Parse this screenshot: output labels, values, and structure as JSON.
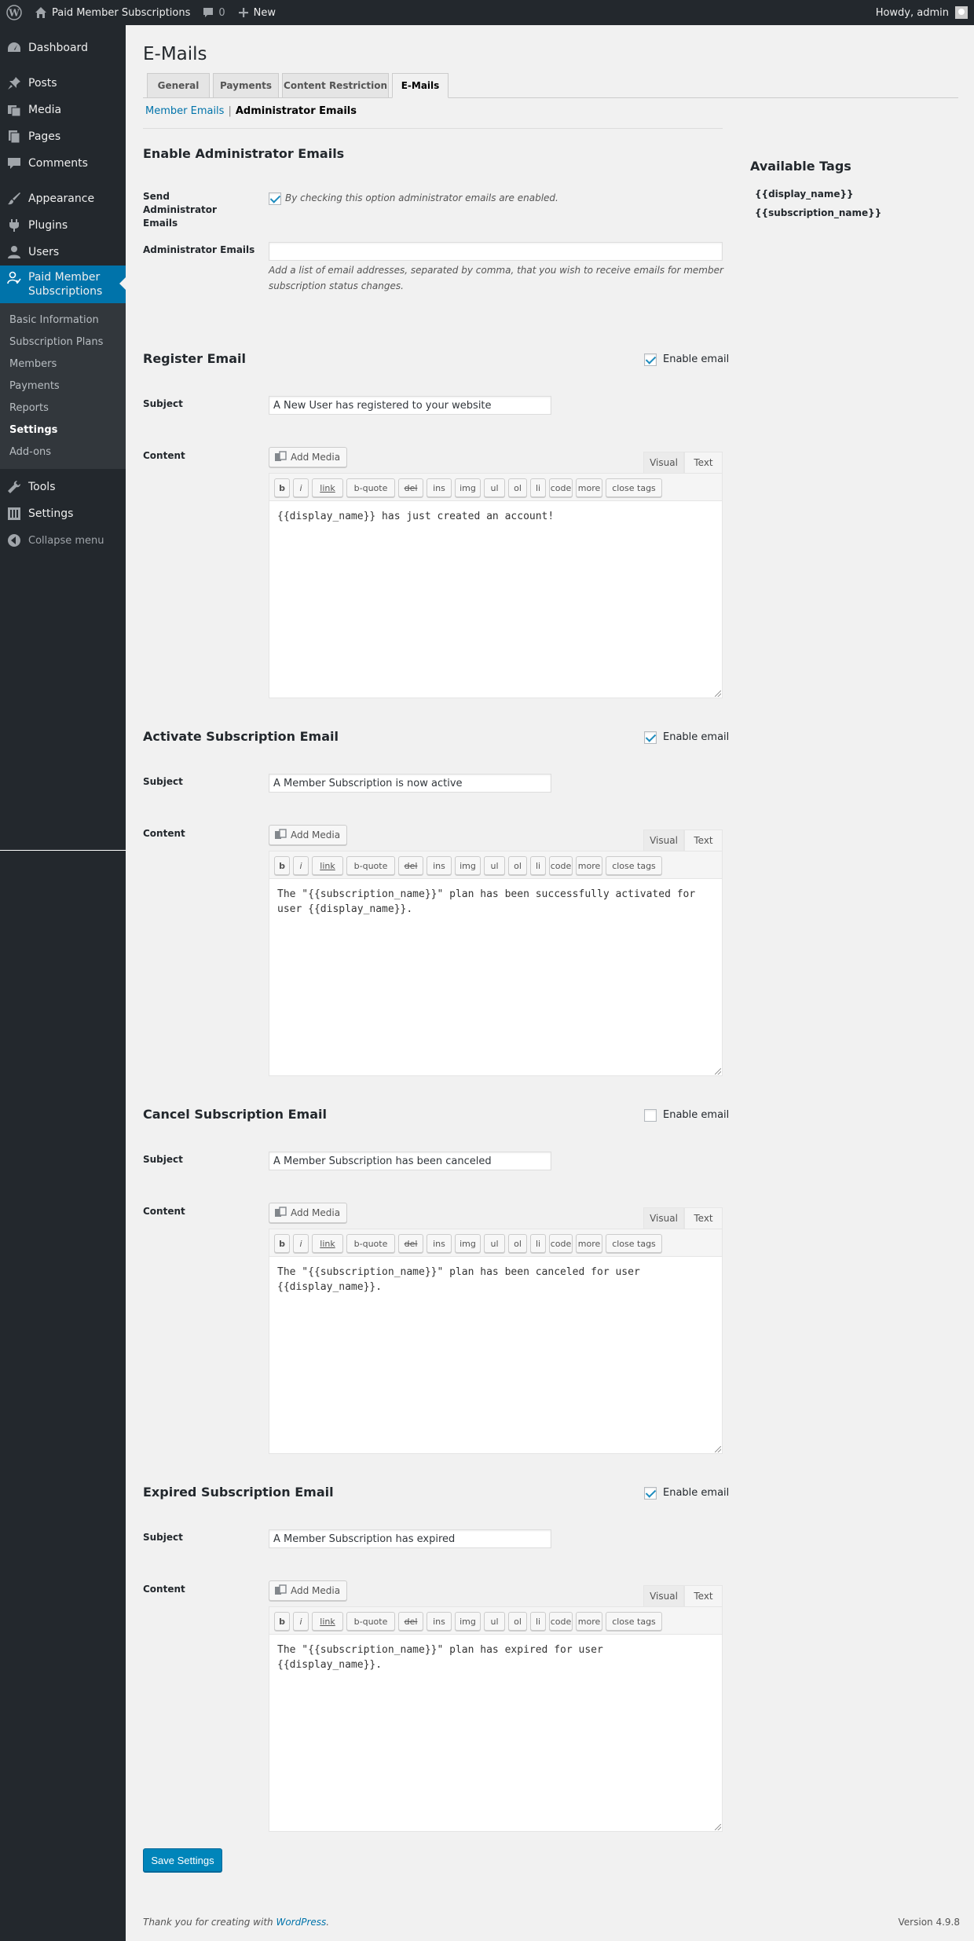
{
  "adminbar": {
    "site_name": "Paid Member Subscriptions",
    "comments_count": "0",
    "new_label": "New",
    "howdy": "Howdy, admin"
  },
  "sidebar": {
    "items": [
      {
        "label": "Dashboard",
        "icon": "dashboard-icon"
      },
      {
        "label": "Posts",
        "icon": "pin-icon"
      },
      {
        "label": "Media",
        "icon": "media-icon"
      },
      {
        "label": "Pages",
        "icon": "pages-icon"
      },
      {
        "label": "Comments",
        "icon": "comments-icon"
      },
      {
        "label": "Appearance",
        "icon": "brush-icon"
      },
      {
        "label": "Plugins",
        "icon": "plug-icon"
      },
      {
        "label": "Users",
        "icon": "users-icon"
      },
      {
        "label": "Paid Member Subscriptions",
        "icon": "member-icon"
      },
      {
        "label": "Tools",
        "icon": "wrench-icon"
      },
      {
        "label": "Settings",
        "icon": "settings-icon"
      }
    ],
    "submenu": [
      "Basic Information",
      "Subscription Plans",
      "Members",
      "Payments",
      "Reports",
      "Settings",
      "Add-ons"
    ],
    "collapse_label": "Collapse menu"
  },
  "page": {
    "title": "E-Mails",
    "tabs": [
      "General",
      "Payments",
      "Content Restriction",
      "E-Mails"
    ],
    "subnav": {
      "member": "Member Emails",
      "sep": "|",
      "admin": "Administrator Emails"
    }
  },
  "admin_section": {
    "title": "Enable Administrator Emails",
    "send_label": "Send Administrator Emails",
    "send_desc": "By checking this option administrator emails are enabled.",
    "send_checked": true,
    "emails_label": "Administrator Emails",
    "emails_value": "",
    "emails_desc_1": "Add a list of email addresses, separated by comma, that you wish to receive emails for member",
    "emails_desc_2": "subscription status changes."
  },
  "common": {
    "enable_email": "Enable email",
    "subject_label": "Subject",
    "content_label": "Content",
    "add_media": "Add Media",
    "visual_tab": "Visual",
    "text_tab": "Text",
    "qt_buttons": [
      "b",
      "i",
      "link",
      "b-quote",
      "del",
      "ins",
      "img",
      "ul",
      "ol",
      "li",
      "code",
      "more",
      "close tags"
    ]
  },
  "emails": [
    {
      "title": "Register Email",
      "enabled": true,
      "subject": "A New User has registered to your website",
      "content": "{{display_name}} has just created an account!"
    },
    {
      "title": "Activate Subscription Email",
      "enabled": true,
      "subject": "A Member Subscription is now active",
      "content": "The \"{{subscription_name}}\" plan has been successfully activated for\nuser {{display_name}}."
    },
    {
      "title": "Cancel Subscription Email",
      "enabled": false,
      "subject": "A Member Subscription has been canceled",
      "content": "The \"{{subscription_name}}\" plan has been canceled for user\n{{display_name}}."
    },
    {
      "title": "Expired Subscription Email",
      "enabled": true,
      "subject": "A Member Subscription has expired",
      "content": "The \"{{subscription_name}}\" plan has expired for user\n{{display_name}}."
    }
  ],
  "tags_panel": {
    "title": "Available Tags",
    "tags": [
      "{{display_name}}",
      "{{subscription_name}}"
    ]
  },
  "save_button": "Save Settings",
  "footer": {
    "thanks_prefix": "Thank you for creating with ",
    "wordpress_link": "WordPress",
    "thanks_suffix": ".",
    "version": "Version 4.9.8"
  }
}
